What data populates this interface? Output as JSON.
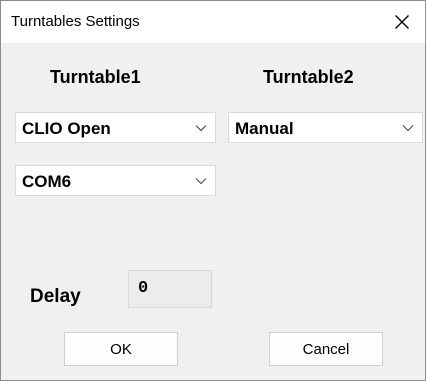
{
  "window": {
    "title": "Turntables Settings",
    "close_icon": "close-icon"
  },
  "turntable1": {
    "heading": "Turntable1",
    "model_select": {
      "value": "CLIO Open",
      "icon": "chevron-down-icon"
    },
    "port_select": {
      "value": "COM6",
      "icon": "chevron-down-icon"
    }
  },
  "turntable2": {
    "heading": "Turntable2",
    "model_select": {
      "value": "Manual",
      "icon": "chevron-down-icon"
    }
  },
  "delay": {
    "label": "Delay",
    "value": "0"
  },
  "buttons": {
    "ok_label": "OK",
    "cancel_label": "Cancel"
  },
  "colors": {
    "dialog_bg": "#f0f0f0",
    "titlebar_bg": "#ffffff",
    "field_bg": "#ffffff",
    "delay_field_bg": "#ececec"
  }
}
